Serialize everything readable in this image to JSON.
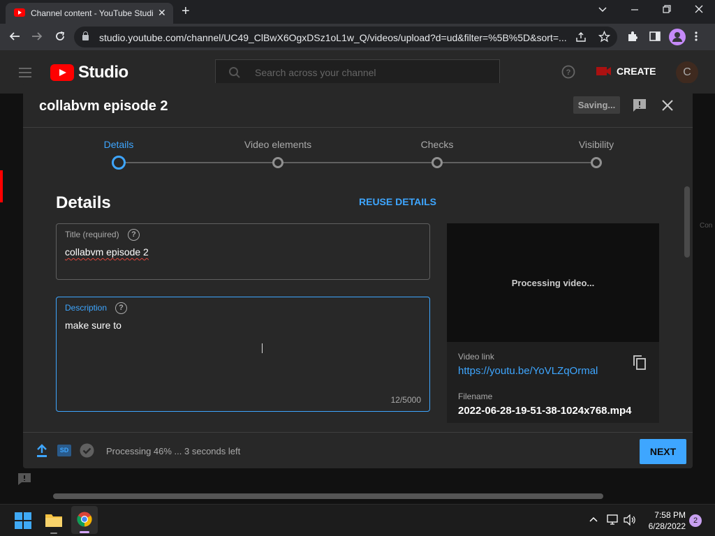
{
  "browser": {
    "tab_title": "Channel content - YouTube Studio",
    "tab_close": "✕",
    "new_tab": "+",
    "url": "studio.youtube.com/channel/UC49_ClBwX6OgxDSz1oL1w_Q/videos/upload?d=ud&filter=%5B%5D&sort=..."
  },
  "studio": {
    "logo_text": "Studio",
    "search_placeholder": "Search across your channel",
    "create_label": "CREATE",
    "avatar_letter": "C",
    "side_text": "Con"
  },
  "dialog": {
    "title": "collabvm episode 2",
    "saving_label": "Saving...",
    "steps": [
      {
        "label": "Details",
        "active": true
      },
      {
        "label": "Video elements",
        "active": false
      },
      {
        "label": "Checks",
        "active": false
      },
      {
        "label": "Visibility",
        "active": false
      }
    ],
    "section_heading": "Details",
    "reuse_label": "REUSE DETAILS",
    "title_field": {
      "label": "Title (required)",
      "value": "collabvm episode 2",
      "help": "?"
    },
    "description_field": {
      "label": "Description",
      "value": "make sure to",
      "help": "?",
      "count": "12/5000"
    },
    "preview": {
      "processing_text": "Processing video...",
      "video_link_label": "Video link",
      "video_link": "https://youtu.be/YoVLZqOrmal",
      "filename_label": "Filename",
      "filename": "2022-06-28-19-51-38-1024x768.mp4"
    },
    "footer": {
      "status": "Processing 46% ... 3 seconds left",
      "hd_badge": "SD",
      "next_label": "NEXT"
    }
  },
  "taskbar": {
    "time": "7:58 PM",
    "date": "6/28/2022",
    "notification_count": "2"
  },
  "colors": {
    "accent": "#3ea6ff",
    "brand_red": "#ff0000",
    "dialog_bg": "#282828"
  }
}
